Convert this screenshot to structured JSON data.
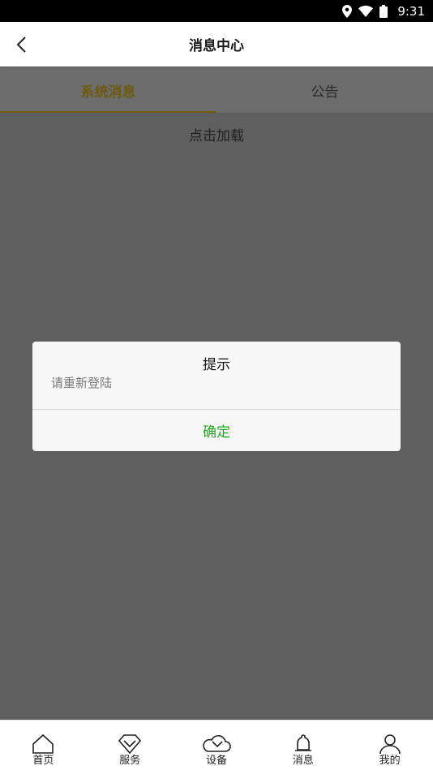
{
  "status_bar": {
    "time": "9:31"
  },
  "header": {
    "title": "消息中心"
  },
  "tabs": [
    {
      "label": "系统消息",
      "active": true
    },
    {
      "label": "公告",
      "active": false
    }
  ],
  "content": {
    "load_more": "点击加载"
  },
  "dialog": {
    "title": "提示",
    "message": "请重新登陆",
    "confirm": "确定"
  },
  "bottom_nav": [
    {
      "label": "首页",
      "icon": "home-icon"
    },
    {
      "label": "服务",
      "icon": "service-icon"
    },
    {
      "label": "设备",
      "icon": "device-icon"
    },
    {
      "label": "消息",
      "icon": "bell-icon"
    },
    {
      "label": "我的",
      "icon": "user-icon"
    }
  ],
  "colors": {
    "accent_tab": "#6e5a10",
    "confirm_green": "#1faa1f",
    "overlay": "#5f5f5f"
  }
}
